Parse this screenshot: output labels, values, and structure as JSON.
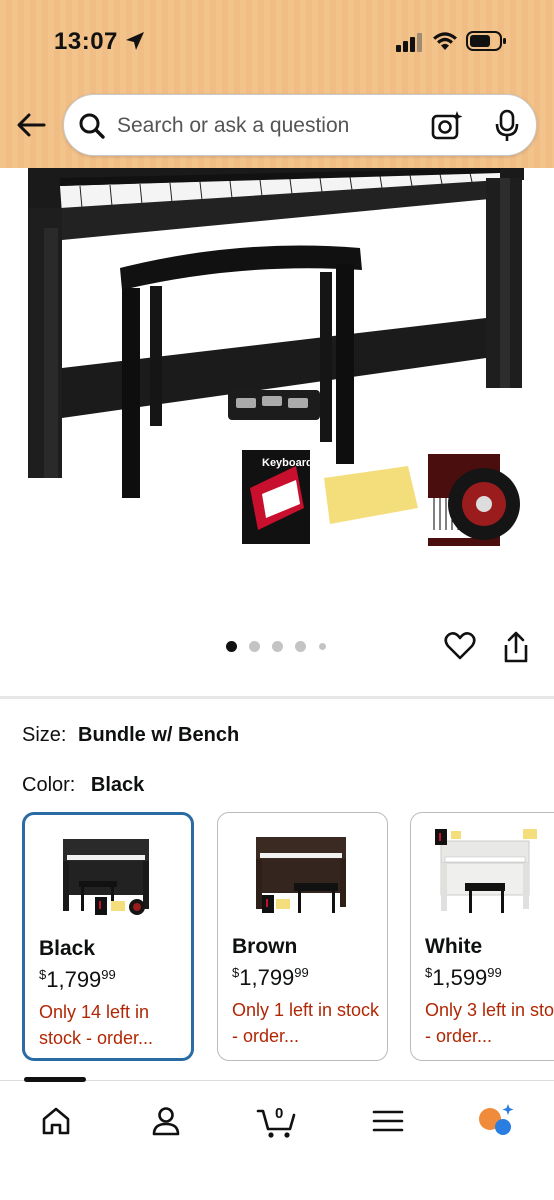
{
  "status": {
    "time": "13:07"
  },
  "search": {
    "placeholder": "Search or ask a question"
  },
  "product": {
    "image_count": 5,
    "current_image": 1,
    "bundle_items": [
      "Keyboard"
    ]
  },
  "size": {
    "label": "Size:",
    "value": "Bundle w/ Bench"
  },
  "color": {
    "label": "Color:",
    "value": "Black"
  },
  "swatches": [
    {
      "name": "Black",
      "currency": "$",
      "price": "1,799",
      "cents": "99",
      "stock": "Only 14 left in stock - order...",
      "selected": true,
      "piano_color": "#2a2a2a"
    },
    {
      "name": "Brown",
      "currency": "$",
      "price": "1,799",
      "cents": "99",
      "stock": "Only 1 left in stock - order...",
      "selected": false,
      "piano_color": "#3a2a22"
    },
    {
      "name": "White",
      "currency": "$",
      "price": "1,599",
      "cents": "99",
      "stock": "Only 3 left in stock - order...",
      "selected": false,
      "piano_color": "#f2f2f0"
    }
  ],
  "nav": {
    "items": [
      "home-icon",
      "account-icon",
      "cart-icon",
      "menu-icon",
      "rufus-icon"
    ],
    "cart_count": "0"
  },
  "colors": {
    "accent_selected": "#2b6ba3",
    "stock_red": "#b12704",
    "header_bg": "#f3c38c",
    "rufus_orange": "#f08b3c",
    "rufus_blue": "#2a7de1"
  }
}
